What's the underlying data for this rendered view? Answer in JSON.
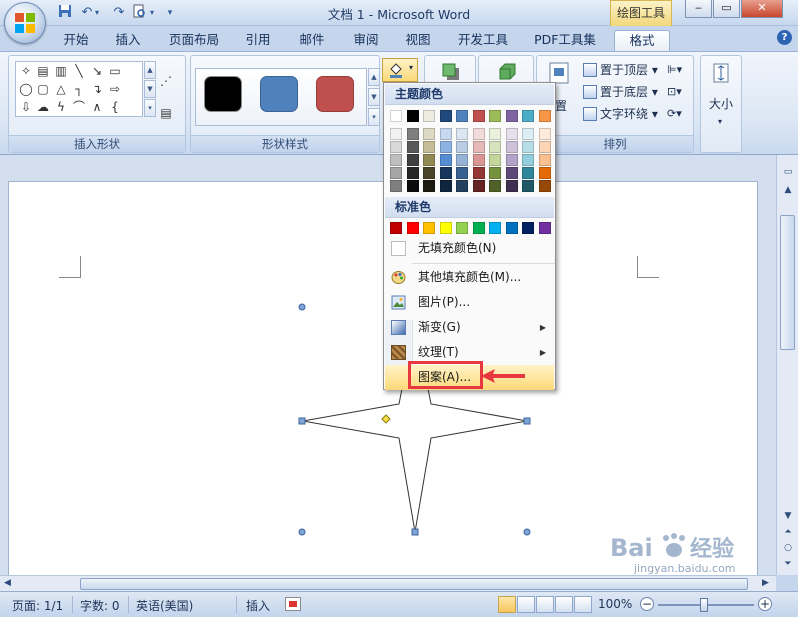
{
  "window": {
    "title": "文档 1 - Microsoft Word",
    "context_tab": "绘图工具",
    "minimize": "‒",
    "maximize": "▭",
    "close": "✕"
  },
  "tabs": [
    {
      "label": "开始"
    },
    {
      "label": "插入"
    },
    {
      "label": "页面布局"
    },
    {
      "label": "引用"
    },
    {
      "label": "邮件"
    },
    {
      "label": "审阅"
    },
    {
      "label": "视图"
    },
    {
      "label": "开发工具"
    },
    {
      "label": "PDF工具集"
    },
    {
      "label": "格式"
    }
  ],
  "help": "?",
  "ribbon": {
    "groups": {
      "insert_shapes": "插入形状",
      "shape_styles": "形状样式",
      "arrange": "排列"
    },
    "arrange": {
      "bring_front": "置于顶层",
      "send_back": "置于底层",
      "text_wrap": "文字环绕",
      "position_partial": "置"
    },
    "size": "大小",
    "style_colors": [
      "#000000",
      "#4f81bd",
      "#c0504d"
    ]
  },
  "fill_menu": {
    "theme_header": "主题颜色",
    "theme_colors_top": [
      "#ffffff",
      "#000000",
      "#eeece1",
      "#1f497d",
      "#4f81bd",
      "#c0504d",
      "#9bbb59",
      "#8064a2",
      "#4bacc6",
      "#f79646"
    ],
    "theme_colors_shades": [
      [
        "#f2f2f2",
        "#7f7f7f",
        "#ddd9c3",
        "#c6d9f0",
        "#dbe5f1",
        "#f2dcdb",
        "#ebf1dd",
        "#e5e0ec",
        "#dbeef3",
        "#fdeada"
      ],
      [
        "#d8d8d8",
        "#595959",
        "#c4bd97",
        "#8db3e2",
        "#b8cce4",
        "#e5b9b7",
        "#d7e3bc",
        "#ccc1d9",
        "#b7dde8",
        "#fbd5b5"
      ],
      [
        "#bfbfbf",
        "#3f3f3f",
        "#938953",
        "#548dd4",
        "#95b3d7",
        "#d99694",
        "#c3d69b",
        "#b2a2c7",
        "#92cddc",
        "#fac08f"
      ],
      [
        "#a5a5a5",
        "#262626",
        "#494429",
        "#17365d",
        "#366092",
        "#953734",
        "#76923c",
        "#5f497a",
        "#31859b",
        "#e36c09"
      ],
      [
        "#7f7f7f",
        "#0c0c0c",
        "#1d1b10",
        "#0f243e",
        "#244061",
        "#632423",
        "#4f6128",
        "#3f3151",
        "#205867",
        "#974806"
      ]
    ],
    "standard_header": "标准色",
    "standard_colors": [
      "#c00000",
      "#ff0000",
      "#ffc000",
      "#ffff00",
      "#92d050",
      "#00b050",
      "#00b0f0",
      "#0070c0",
      "#002060",
      "#7030a0"
    ],
    "items": {
      "no_fill": "无填充颜色(N)",
      "more_colors": "其他填充颜色(M)...",
      "picture": "图片(P)...",
      "gradient": "渐变(G)",
      "texture": "纹理(T)",
      "pattern": "图案(A)..."
    }
  },
  "status": {
    "page": "页面: 1/1",
    "words": "字数: 0",
    "language": "英语(美国)",
    "mode": "插入",
    "zoom": "100%"
  },
  "watermark": {
    "url": "jingyan.baidu.com"
  },
  "colors": {
    "accent": "#e8383f",
    "hover": "#fbd978"
  }
}
